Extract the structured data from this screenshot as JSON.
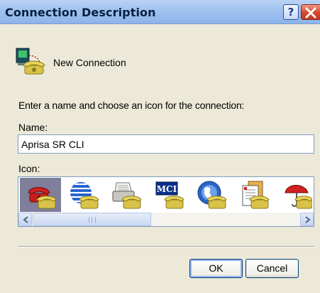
{
  "window": {
    "title": "Connection Description",
    "help_label": "?"
  },
  "header": {
    "connection_name": "New Connection",
    "icon": "network-phone-icon"
  },
  "form": {
    "prompt": "Enter a name and choose an icon for the connection:",
    "name_label": "Name:",
    "name_value": "Aprisa SR CLI",
    "icon_label": "Icon:"
  },
  "icon_list": {
    "items": [
      {
        "icon": "red-telephone-icon",
        "selected": true
      },
      {
        "icon": "globe-phone-icon",
        "selected": false
      },
      {
        "icon": "fax-phone-icon",
        "selected": false
      },
      {
        "icon": "mci-phone-icon",
        "text": "MCI",
        "selected": false
      },
      {
        "icon": "world-phone-icon",
        "selected": false
      },
      {
        "icon": "notepad-phone-icon",
        "selected": false
      },
      {
        "icon": "umbrella-phone-icon",
        "selected": false
      }
    ]
  },
  "buttons": {
    "ok": "OK",
    "cancel": "Cancel"
  },
  "colors": {
    "window_bg": "#ece9d8",
    "title_bar": "#9fc2ef",
    "selection": "#7f7f9a",
    "button_border": "#003c74"
  }
}
